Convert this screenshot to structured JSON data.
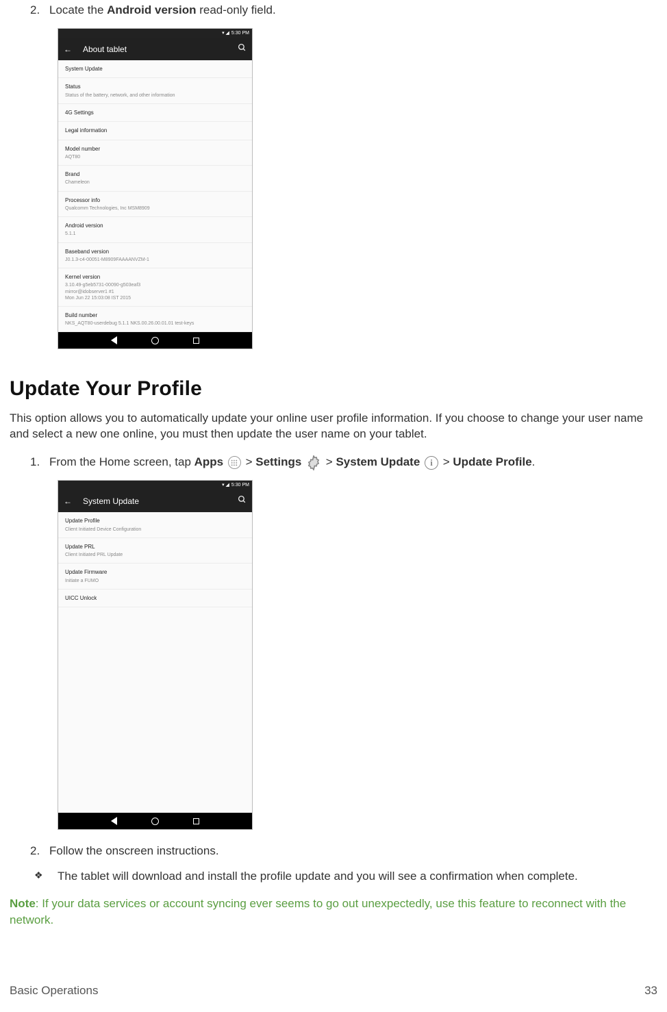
{
  "step_top": {
    "num": "2.",
    "pre": "Locate the ",
    "bold": "Android version",
    "post": " read-only field."
  },
  "phone1": {
    "status_time": "5:30 PM",
    "appbar_title": "About tablet",
    "items": [
      {
        "title": "System Update",
        "sub": ""
      },
      {
        "title": "Status",
        "sub": "Status of the battery, network, and other information"
      },
      {
        "title": "4G Settings",
        "sub": ""
      },
      {
        "title": "Legal information",
        "sub": ""
      },
      {
        "title": "Model number",
        "sub": "AQT80"
      },
      {
        "title": "Brand",
        "sub": "Chameleon"
      },
      {
        "title": "Processor info",
        "sub": "Qualcomm Technologies, Inc MSM8909"
      },
      {
        "title": "Android version",
        "sub": "5.1.1"
      },
      {
        "title": "Baseband version",
        "sub": "J0.1.3-c4-00051-M8909FAAAANVZM-1"
      },
      {
        "title": "Kernel version",
        "sub": "3.10.49-g5eb5731-00090-g503eaf3\nmirror@idobserver1 #1\nMon Jun 22 15:03:08 IST 2015"
      },
      {
        "title": "Build number",
        "sub": "NKS_AQT80-userdebug 5.1.1 NKS.00.26.00.01.01 test-keys"
      }
    ]
  },
  "heading": "Update Your Profile",
  "intro": "This option allows you to automatically update your online user profile information. If you choose to change your user name and select a new one online, you must then update the user name on your tablet.",
  "nav_step": {
    "num": "1.",
    "seg1": "From the Home screen, tap ",
    "apps": "Apps",
    "gt": " > ",
    "settings": "Settings",
    "sysupdate": "System Update",
    "updprof": "Update Profile",
    "dot": "."
  },
  "phone2": {
    "status_time": "5:30 PM",
    "appbar_title": "System Update",
    "items": [
      {
        "title": "Update Profile",
        "sub": "Client Initiated Device Configuration"
      },
      {
        "title": "Update PRL",
        "sub": "Client Initiated PRL Update"
      },
      {
        "title": "Update Firmware",
        "sub": "Initiate a FUMO"
      },
      {
        "title": "UICC Unlock",
        "sub": ""
      }
    ]
  },
  "step_follow": {
    "num": "2.",
    "text": "Follow the onscreen instructions."
  },
  "bullet": {
    "mark": "❖",
    "text": "The tablet will download and install the profile update and you will see a confirmation when complete."
  },
  "note": {
    "label": "Note",
    "text": ": If your data services or account syncing ever seems to go out unexpectedly, use this feature to reconnect with the network."
  },
  "footer": {
    "left": "Basic Operations",
    "right": "33"
  }
}
